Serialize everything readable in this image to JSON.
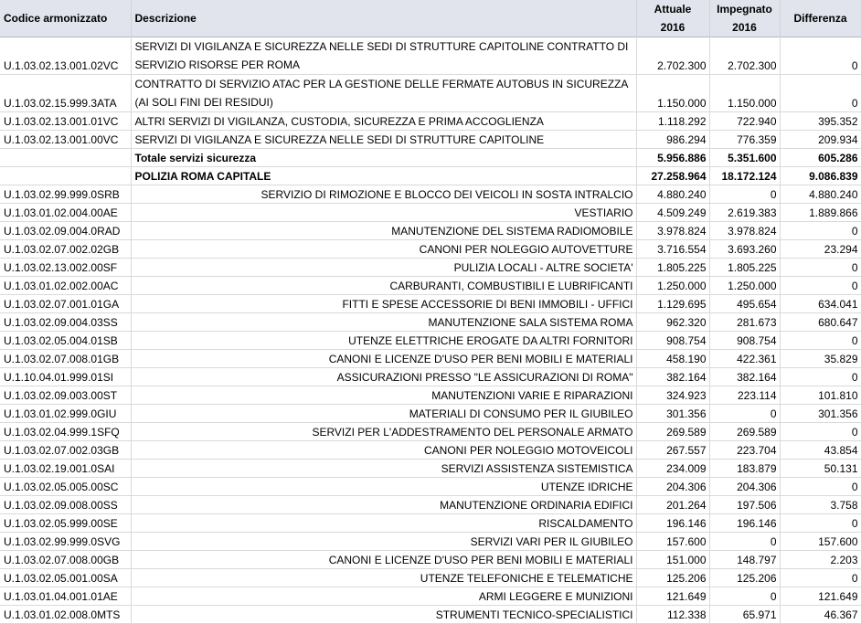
{
  "headers": {
    "code": "Codice armonizzato",
    "desc": "Descrizione",
    "actual_l1": "Attuale",
    "actual_l2": "2016",
    "committed_l1": "Impegnato",
    "committed_l2": "2016",
    "diff": "Differenza"
  },
  "top_rows": [
    {
      "code": "U.1.03.02.13.001.02VC",
      "desc": "SERVIZI DI VIGILANZA E SICUREZZA NELLE SEDI DI STRUTTURE CAPITOLINE CONTRATTO DI SERVIZIO RISORSE PER ROMA",
      "actual": "2.702.300",
      "committed": "2.702.300",
      "diff": "0"
    },
    {
      "code": "U.1.03.02.15.999.3ATA",
      "desc": "CONTRATTO DI SERVIZIO ATAC PER LA GESTIONE DELLE FERMATE AUTOBUS IN SICUREZZA (AI SOLI FINI DEI RESIDUI)",
      "actual": "1.150.000",
      "committed": "1.150.000",
      "diff": "0"
    },
    {
      "code": "U.1.03.02.13.001.01VC",
      "desc": "ALTRI SERVIZI DI VIGILANZA, CUSTODIA,  SICUREZZA E PRIMA ACCOGLIENZA",
      "actual": "1.118.292",
      "committed": "722.940",
      "diff": "395.352"
    },
    {
      "code": "U.1.03.02.13.001.00VC",
      "desc": "SERVIZI DI VIGILANZA E SICUREZZA NELLE SEDI DI STRUTTURE CAPITOLINE",
      "actual": "986.294",
      "committed": "776.359",
      "diff": "209.934"
    }
  ],
  "totals": [
    {
      "code": "",
      "desc": "Totale servizi sicurezza",
      "actual": "5.956.886",
      "committed": "5.351.600",
      "diff": "605.286"
    },
    {
      "code": "",
      "desc": "POLIZIA ROMA CAPITALE",
      "actual": "27.258.964",
      "committed": "18.172.124",
      "diff": "9.086.839"
    }
  ],
  "rows": [
    {
      "code": "U.1.03.02.99.999.0SRB",
      "desc": "SERVIZIO DI RIMOZIONE E BLOCCO DEI VEICOLI IN SOSTA INTRALCIO",
      "actual": "4.880.240",
      "committed": "0",
      "diff": "4.880.240"
    },
    {
      "code": "U.1.03.01.02.004.00AE",
      "desc": "VESTIARIO",
      "actual": "4.509.249",
      "committed": "2.619.383",
      "diff": "1.889.866"
    },
    {
      "code": "U.1.03.02.09.004.0RAD",
      "desc": "MANUTENZIONE DEL SISTEMA RADIOMOBILE",
      "actual": "3.978.824",
      "committed": "3.978.824",
      "diff": "0"
    },
    {
      "code": "U.1.03.02.07.002.02GB",
      "desc": "CANONI PER NOLEGGIO AUTOVETTURE",
      "actual": "3.716.554",
      "committed": "3.693.260",
      "diff": "23.294"
    },
    {
      "code": "U.1.03.02.13.002.00SF",
      "desc": "PULIZIA LOCALI - ALTRE SOCIETA'",
      "actual": "1.805.225",
      "committed": "1.805.225",
      "diff": "0"
    },
    {
      "code": "U.1.03.01.02.002.00AC",
      "desc": "CARBURANTI, COMBUSTIBILI E LUBRIFICANTI",
      "actual": "1.250.000",
      "committed": "1.250.000",
      "diff": "0"
    },
    {
      "code": "U.1.03.02.07.001.01GA",
      "desc": "FITTI E SPESE ACCESSORIE DI BENI IMMOBILI - UFFICI",
      "actual": "1.129.695",
      "committed": "495.654",
      "diff": "634.041"
    },
    {
      "code": "U.1.03.02.09.004.03SS",
      "desc": "MANUTENZIONE  SALA SISTEMA ROMA",
      "actual": "962.320",
      "committed": "281.673",
      "diff": "680.647"
    },
    {
      "code": "U.1.03.02.05.004.01SB",
      "desc": "UTENZE ELETTRICHE EROGATE DA ALTRI FORNITORI",
      "actual": "908.754",
      "committed": "908.754",
      "diff": "0"
    },
    {
      "code": "U.1.03.02.07.008.01GB",
      "desc": "CANONI E LICENZE D'USO PER BENI MOBILI E MATERIALI",
      "actual": "458.190",
      "committed": "422.361",
      "diff": "35.829"
    },
    {
      "code": "U.1.10.04.01.999.01SI",
      "desc": "ASSICURAZIONI PRESSO \"LE ASSICURAZIONI DI ROMA\"",
      "actual": "382.164",
      "committed": "382.164",
      "diff": "0"
    },
    {
      "code": "U.1.03.02.09.003.00ST",
      "desc": "MANUTENZIONI VARIE E RIPARAZIONI",
      "actual": "324.923",
      "committed": "223.114",
      "diff": "101.810"
    },
    {
      "code": "U.1.03.01.02.999.0GIU",
      "desc": "MATERIALI DI CONSUMO PER IL GIUBILEO",
      "actual": "301.356",
      "committed": "0",
      "diff": "301.356"
    },
    {
      "code": "U.1.03.02.04.999.1SFQ",
      "desc": "SERVIZI PER L'ADDESTRAMENTO DEL PERSONALE ARMATO",
      "actual": "269.589",
      "committed": "269.589",
      "diff": "0"
    },
    {
      "code": "U.1.03.02.07.002.03GB",
      "desc": "CANONI PER NOLEGGIO MOTOVEICOLI",
      "actual": "267.557",
      "committed": "223.704",
      "diff": "43.854"
    },
    {
      "code": "U.1.03.02.19.001.0SAI",
      "desc": "SERVIZI ASSISTENZA SISTEMISTICA",
      "actual": "234.009",
      "committed": "183.879",
      "diff": "50.131"
    },
    {
      "code": "U.1.03.02.05.005.00SC",
      "desc": "UTENZE IDRICHE",
      "actual": "204.306",
      "committed": "204.306",
      "diff": "0"
    },
    {
      "code": "U.1.03.02.09.008.00SS",
      "desc": "MANUTENZIONE ORDINARIA EDIFICI",
      "actual": "201.264",
      "committed": "197.506",
      "diff": "3.758"
    },
    {
      "code": "U.1.03.02.05.999.00SE",
      "desc": "RISCALDAMENTO",
      "actual": "196.146",
      "committed": "196.146",
      "diff": "0"
    },
    {
      "code": "U.1.03.02.99.999.0SVG",
      "desc": "SERVIZI VARI PER IL GIUBILEO",
      "actual": "157.600",
      "committed": "0",
      "diff": "157.600"
    },
    {
      "code": "U.1.03.02.07.008.00GB",
      "desc": "CANONI E LICENZE D'USO PER BENI MOBILI E MATERIALI",
      "actual": "151.000",
      "committed": "148.797",
      "diff": "2.203"
    },
    {
      "code": "U.1.03.02.05.001.00SA",
      "desc": "UTENZE TELEFONICHE E TELEMATICHE",
      "actual": "125.206",
      "committed": "125.206",
      "diff": "0"
    },
    {
      "code": "U.1.03.01.04.001.01AE",
      "desc": "ARMI LEGGERE E MUNIZIONI",
      "actual": "121.649",
      "committed": "0",
      "diff": "121.649"
    },
    {
      "code": "U.1.03.01.02.008.0MTS",
      "desc": "STRUMENTI TECNICO-SPECIALISTICI",
      "actual": "112.338",
      "committed": "65.971",
      "diff": "46.367"
    }
  ]
}
